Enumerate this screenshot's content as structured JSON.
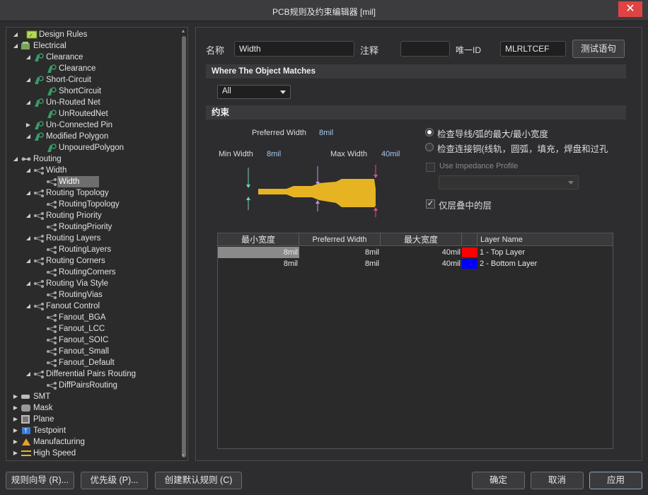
{
  "window": {
    "title": "PCB规则及约束编辑器 [mil]",
    "close_glyph": "✕"
  },
  "tree": {
    "root": "Design Rules",
    "items": [
      {
        "label": "Electrical",
        "level": 1,
        "expanded": true,
        "icon": "electrical-icon"
      },
      {
        "label": "Clearance",
        "level": 2,
        "expanded": true,
        "icon": "rule-class-icon"
      },
      {
        "label": "Clearance",
        "level": 3,
        "icon": "rule-icon"
      },
      {
        "label": "Short-Circuit",
        "level": 2,
        "expanded": true,
        "icon": "rule-class-icon"
      },
      {
        "label": "ShortCircuit",
        "level": 3,
        "icon": "rule-icon"
      },
      {
        "label": "Un-Routed Net",
        "level": 2,
        "expanded": true,
        "icon": "rule-class-icon"
      },
      {
        "label": "UnRoutedNet",
        "level": 3,
        "icon": "rule-icon"
      },
      {
        "label": "Un-Connected Pin",
        "level": 2,
        "expanded": false,
        "icon": "rule-class-icon"
      },
      {
        "label": "Modified Polygon",
        "level": 2,
        "expanded": true,
        "icon": "rule-class-icon"
      },
      {
        "label": "UnpouredPolygon",
        "level": 3,
        "icon": "rule-icon"
      },
      {
        "label": "Routing",
        "level": 1,
        "expanded": true,
        "icon": "routing-icon"
      },
      {
        "label": "Width",
        "level": 2,
        "expanded": true,
        "icon": "routing-rule-class-icon"
      },
      {
        "label": "Width",
        "level": 3,
        "icon": "routing-rule-icon",
        "selected": true
      },
      {
        "label": "Routing Topology",
        "level": 2,
        "expanded": true,
        "icon": "routing-rule-class-icon"
      },
      {
        "label": "RoutingTopology",
        "level": 3,
        "icon": "routing-rule-icon"
      },
      {
        "label": "Routing Priority",
        "level": 2,
        "expanded": true,
        "icon": "routing-rule-class-icon"
      },
      {
        "label": "RoutingPriority",
        "level": 3,
        "icon": "routing-rule-icon"
      },
      {
        "label": "Routing Layers",
        "level": 2,
        "expanded": true,
        "icon": "routing-rule-class-icon"
      },
      {
        "label": "RoutingLayers",
        "level": 3,
        "icon": "routing-rule-icon"
      },
      {
        "label": "Routing Corners",
        "level": 2,
        "expanded": true,
        "icon": "routing-rule-class-icon"
      },
      {
        "label": "RoutingCorners",
        "level": 3,
        "icon": "routing-rule-icon"
      },
      {
        "label": "Routing Via Style",
        "level": 2,
        "expanded": true,
        "icon": "routing-rule-class-icon"
      },
      {
        "label": "RoutingVias",
        "level": 3,
        "icon": "routing-rule-icon"
      },
      {
        "label": "Fanout Control",
        "level": 2,
        "expanded": true,
        "icon": "routing-rule-class-icon"
      },
      {
        "label": "Fanout_BGA",
        "level": 3,
        "icon": "routing-rule-icon"
      },
      {
        "label": "Fanout_LCC",
        "level": 3,
        "icon": "routing-rule-icon"
      },
      {
        "label": "Fanout_SOIC",
        "level": 3,
        "icon": "routing-rule-icon"
      },
      {
        "label": "Fanout_Small",
        "level": 3,
        "icon": "routing-rule-icon"
      },
      {
        "label": "Fanout_Default",
        "level": 3,
        "icon": "routing-rule-icon"
      },
      {
        "label": "Differential Pairs Routing",
        "level": 2,
        "expanded": true,
        "icon": "routing-rule-class-icon"
      },
      {
        "label": "DiffPairsRouting",
        "level": 3,
        "icon": "routing-rule-icon"
      },
      {
        "label": "SMT",
        "level": 1,
        "expanded": false,
        "icon": "smt-icon"
      },
      {
        "label": "Mask",
        "level": 1,
        "expanded": false,
        "icon": "mask-icon"
      },
      {
        "label": "Plane",
        "level": 1,
        "expanded": false,
        "icon": "plane-icon"
      },
      {
        "label": "Testpoint",
        "level": 1,
        "expanded": false,
        "icon": "testpoint-icon"
      },
      {
        "label": "Manufacturing",
        "level": 1,
        "expanded": false,
        "icon": "manufacturing-icon"
      },
      {
        "label": "High Speed",
        "level": 1,
        "expanded": false,
        "icon": "high-speed-icon"
      }
    ]
  },
  "rule": {
    "name_label": "名称",
    "name_value": "Width",
    "comment_label": "注释",
    "comment_value": "",
    "uid_label": "唯一ID",
    "uid_value": "MLRLTCEF",
    "test_button": "测试语句"
  },
  "where": {
    "header": "Where The Object Matches",
    "scope_value": "All"
  },
  "constraints": {
    "header": "约束",
    "preferred_label": "Preferred Width",
    "preferred_value": "8mil",
    "min_label": "Min Width",
    "min_value": "8mil",
    "max_label": "Max Width",
    "max_value": "40mil",
    "radio_1": "检查导线/弧的最大/最小宽度",
    "radio_1_checked": true,
    "radio_2": "检查连接铜(线轨，圆弧，填充，焊盘和过孔",
    "radio_2_checked": false,
    "impedance_label": "Use Impedance Profile",
    "stack_only_label": "仅层叠中的层",
    "stack_only_checked": true,
    "trace_color": "#e6b422"
  },
  "grid": {
    "headers": [
      "最小宽度",
      "Preferred Width",
      "最大宽度",
      "",
      "Layer Name"
    ],
    "rows": [
      {
        "min": "8mil",
        "pref": "8mil",
        "max": "40mil",
        "color": "#ff0000",
        "layer": "1 - Top Layer"
      },
      {
        "min": "8mil",
        "pref": "8mil",
        "max": "40mil",
        "color": "#0000ff",
        "layer": "2 - Bottom Layer"
      }
    ]
  },
  "buttons": {
    "wizard": "规则向导 (R)...",
    "priority": "优先级 (P)...",
    "create_default": "创建默认规则 (C)",
    "ok": "确定",
    "cancel": "取消",
    "apply": "应用"
  }
}
